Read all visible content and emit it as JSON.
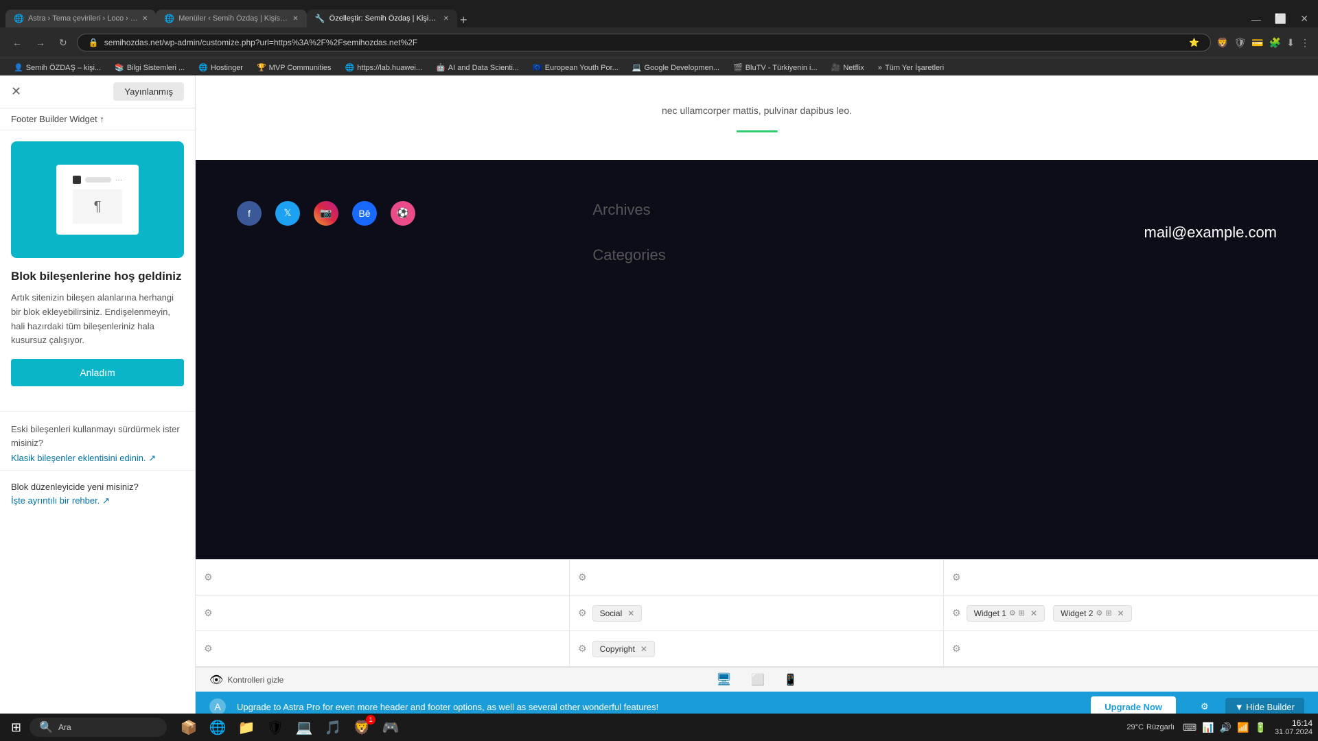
{
  "browser": {
    "tabs": [
      {
        "id": "tab1",
        "label": "Astra › Tema çevirileri › Loco › Semi...",
        "active": false,
        "favicon": "🌐"
      },
      {
        "id": "tab2",
        "label": "Menüler ‹ Semih Özdaş | Kişisel web...",
        "active": false,
        "favicon": "🌐"
      },
      {
        "id": "tab3",
        "label": "Özelleştir: Semih Özdaş | Kişisel...",
        "active": true,
        "favicon": "🔧"
      }
    ],
    "address": "semihozdas.net/wp-admin/customize.php?url=https%3A%2F%2Fsemihozdas.net%2F",
    "bookmarks": [
      "Semin ÖZDAŞ – kişi...",
      "Bilgi Sistemleri ...",
      "Hostinger",
      "MVP Communities",
      "https://lab.huawei...",
      "AI and Data Scienti...",
      "European Youth Por...",
      "Google Developmen...",
      "BluTV - Türkiyenin i...",
      "Netflix",
      "Tüm Yer İşaretleri"
    ]
  },
  "sidebar": {
    "close_label": "✕",
    "publish_label": "Yayınlanmış",
    "breadcrumb": "Footer Builder Widget ↑",
    "widget_title": "Blok bileşenlerine hoş geldiniz",
    "widget_desc": "Artık sitenizin bileşen alanlarına herhangi bir blok ekleyebilirsiniz. Endişelenmeyin, hali hazırdaki tüm bileşenleriniz hala kusursuz çalışıyor.",
    "anladim_label": "Anladım",
    "old_components_title": "Eski bileşenleri kullanmayı sürdürmek ister misiniz?",
    "classic_link": "Klasik bileşenler eklentisini edinin.",
    "block_editor_title": "Blok düzenleyicide yeni misiniz?",
    "detail_link": "İşte ayrıntılı bir rehber."
  },
  "site_preview": {
    "body_text": "nec ullamcorper mattis, pulvinar dapibus leo.",
    "divider_color": "#2ecc71",
    "footer_sections": [
      "Archives",
      "Categories"
    ],
    "social_icons": [
      "facebook",
      "twitter",
      "instagram",
      "behance",
      "dribbble"
    ],
    "email": "mail@example.com"
  },
  "builder": {
    "rows": [
      {
        "cells": [
          {
            "gear": true,
            "widgets": []
          },
          {
            "gear": true,
            "widgets": []
          },
          {
            "gear": true,
            "widgets": []
          }
        ]
      },
      {
        "cells": [
          {
            "gear": true,
            "widgets": []
          },
          {
            "gear": true,
            "widgets": [
              {
                "label": "Social",
                "closable": true
              }
            ]
          },
          {
            "gear": true,
            "widgets": [
              {
                "label": "Widget 1",
                "closable": true
              },
              {
                "label": "Widget 2",
                "closable": true
              }
            ]
          }
        ]
      },
      {
        "cells": [
          {
            "gear": true,
            "widgets": []
          },
          {
            "gear": true,
            "widgets": [
              {
                "label": "Copyright",
                "closable": true
              }
            ]
          },
          {
            "gear": true,
            "widgets": []
          }
        ]
      }
    ]
  },
  "bottom_bar": {
    "text": "Upgrade to Astra Pro for even more header and footer options, as well as several other wonderful features!",
    "upgrade_label": "Upgrade Now",
    "hide_builder_label": "▼ Hide Builder"
  },
  "device_toolbar": {
    "controls_label": "Kontrolleri gizle",
    "desktop": "🖥",
    "tablet": "📱",
    "mobile": "📱"
  },
  "taskbar": {
    "search_placeholder": "Ara",
    "time": "16:14",
    "date": "31.07.2024",
    "weather": "29°C",
    "weather_desc": "Rüzgarlı",
    "notif_count": "1"
  },
  "footer_builder_settings": {
    "gear_label": "⚙"
  }
}
